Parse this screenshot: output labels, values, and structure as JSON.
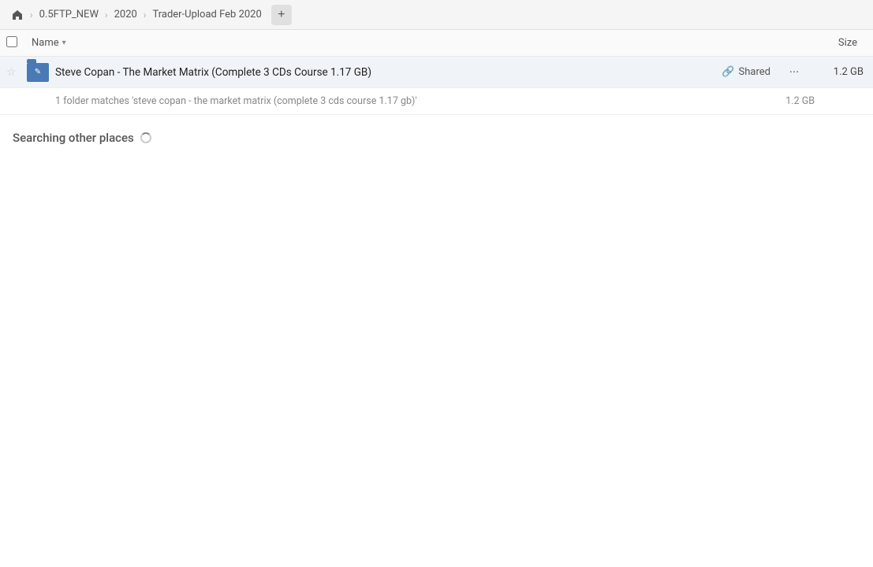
{
  "breadcrumb": {
    "home_icon": "🏠",
    "items": [
      {
        "label": "0.5FTP_NEW"
      },
      {
        "label": "2020"
      },
      {
        "label": "Trader-Upload Feb 2020"
      }
    ],
    "add_button_label": "+"
  },
  "column_header": {
    "name_label": "Name",
    "size_label": "Size"
  },
  "file_row": {
    "name": "Steve Copan - The Market Matrix (Complete 3 CDs Course 1.17 GB)",
    "shared_label": "Shared",
    "size": "1.2 GB",
    "more_icon": "···"
  },
  "match_info": {
    "text": "1 folder matches 'steve copan - the market matrix (complete 3 cds course 1.17 gb)'",
    "size": "1.2 GB"
  },
  "searching": {
    "label": "Searching other places"
  }
}
